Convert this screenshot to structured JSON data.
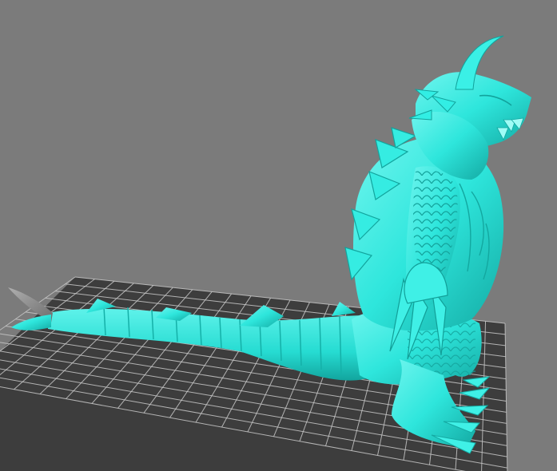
{
  "viewport": {
    "background_color": "#7b7b7b",
    "build_plate": {
      "fill_color": "#3d3d3d",
      "grid_line_color": "#c8c8c8"
    },
    "model": {
      "body_color": "#2ee6dc",
      "shade_color": "#18b8b0",
      "highlight_color": "#8ffcf4",
      "tail_tip_color": "#8a8a8a"
    }
  }
}
